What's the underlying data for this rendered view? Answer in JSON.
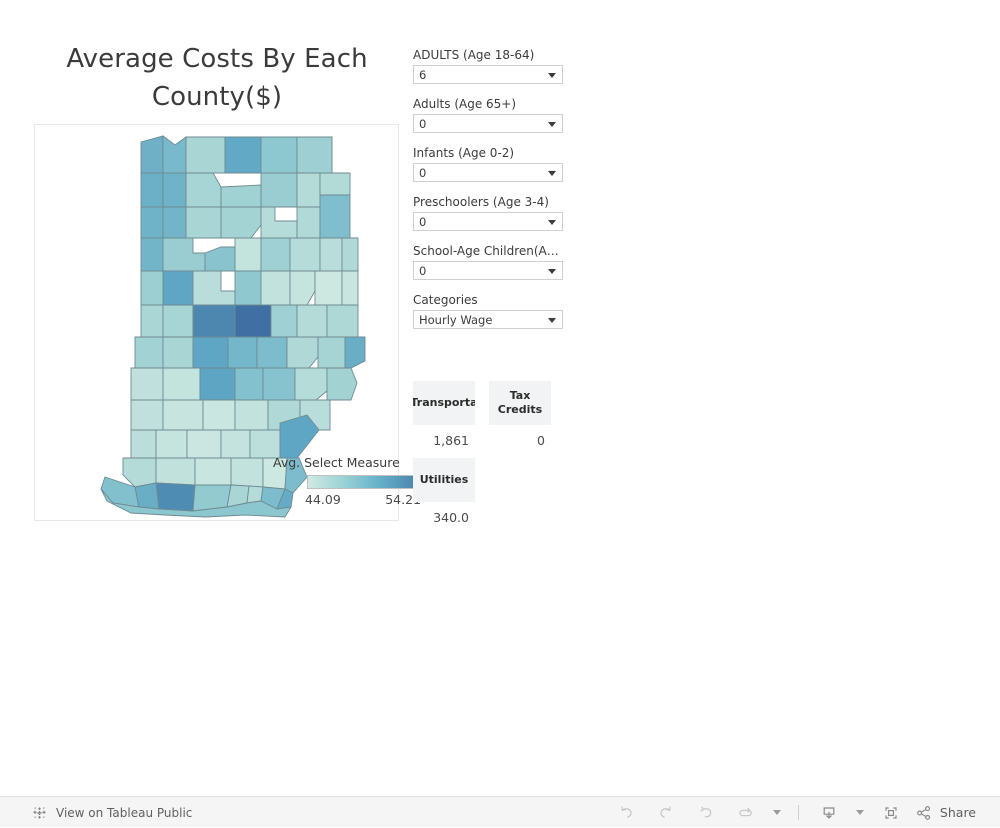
{
  "dashboard": {
    "title": "Average Costs By Each County($)"
  },
  "map": {
    "region": "Indiana",
    "legend": {
      "title": "Avg. Select Measure",
      "min": "44.09",
      "max": "54.21",
      "gradient_start": "#cfe9e2",
      "gradient_end": "#4a82ac"
    }
  },
  "filters": [
    {
      "label": "ADULTS (Age 18-64)",
      "value": "6"
    },
    {
      "label": "Adults (Age 65+)",
      "value": "0"
    },
    {
      "label": "Infants (Age 0-2)",
      "value": "0"
    },
    {
      "label": "Preschoolers (Age 3-4)",
      "value": "0"
    },
    {
      "label": "School-Age Children(Age…",
      "value": "0"
    },
    {
      "label": "Categories",
      "value": "Hourly Wage"
    }
  ],
  "metrics": [
    {
      "name": "Transporta",
      "value": "1,861"
    },
    {
      "name": "Tax Credits",
      "value": "0"
    },
    {
      "name": "Utilities",
      "value": "340.0"
    }
  ],
  "footer": {
    "view_label": "View on Tableau Public",
    "share_label": "Share"
  }
}
